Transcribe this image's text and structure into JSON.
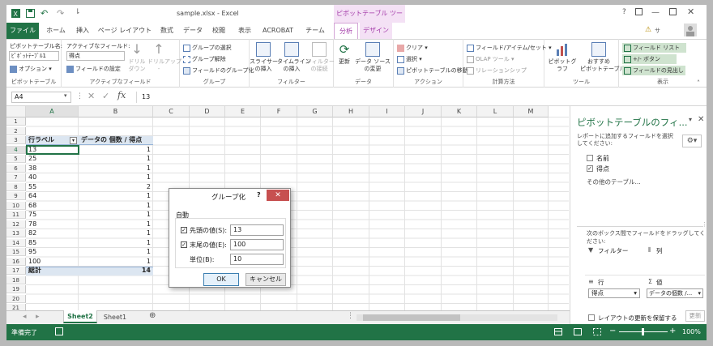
{
  "title": {
    "filename": "sample.xlsx - Excel",
    "context": "ピボットテーブル ツール",
    "help": "?",
    "user": "サ"
  },
  "tabs": [
    "ファイル",
    "ホーム",
    "挿入",
    "ページ レイアウト",
    "数式",
    "データ",
    "校閲",
    "表示",
    "ACROBAT",
    "チーム",
    "分析",
    "デザイン"
  ],
  "ribbon": {
    "pt_name_label": "ピボットテーブル名:",
    "pt_name_value": "ﾋﾟﾎﾞｯﾄﾃｰﾌﾞﾙ1",
    "options": "オプション",
    "g1": "ピボットテーブル",
    "active_field_label": "アクティブなフィールド:",
    "active_field_value": "得点",
    "field_settings": "フィールドの設定",
    "drill_down": "ドリル\nダウン",
    "drill_up": "ドリルアップ\n-",
    "g2": "アクティブなフィールド",
    "group_sel": "グループの選択",
    "ungroup": "グループ解除",
    "group_field": "フィールドのグループ化",
    "g3": "グループ",
    "slicer": "スライサー\nの挿入",
    "timeline": "タイムライン\nの挿入",
    "filter_conn": "フィルター\nの接続",
    "g4": "フィルター",
    "refresh": "更新",
    "change_source": "データ ソース\nの変更",
    "g5": "データ",
    "clear": "クリア",
    "select": "選択",
    "move_pt": "ピボットテーブルの移動",
    "g6": "アクション",
    "fields_items": "フィールド/アイテム/セット",
    "olap": "OLAP ツール",
    "relationships": "リレーションシップ",
    "g7": "計算方法",
    "pivot_chart": "ピボットグラフ",
    "recommended": "おすすめ\nピボットテーブル",
    "g8": "ツール",
    "field_list": "フィールド リスト",
    "plus_minus": "+/- ボタン",
    "field_headers": "フィールドの見出し",
    "g9": "表示"
  },
  "formula": {
    "namebox": "A4",
    "fx": "fx",
    "value": "13"
  },
  "columns": [
    "A",
    "B",
    "C",
    "D",
    "E",
    "F",
    "G",
    "H",
    "I",
    "J",
    "K",
    "L",
    "M"
  ],
  "rows": [
    "1",
    "2",
    "3",
    "4",
    "5",
    "6",
    "7",
    "8",
    "9",
    "10",
    "11",
    "12",
    "13",
    "14",
    "15",
    "16",
    "17",
    "18",
    "19",
    "20",
    "21",
    "22"
  ],
  "pivot": {
    "header_a": "行ラベル",
    "header_b": "データの 個数 / 得点",
    "labels": [
      "13",
      "25",
      "38",
      "40",
      "55",
      "64",
      "68",
      "75",
      "78",
      "82",
      "85",
      "95",
      "100"
    ],
    "counts": [
      "1",
      "1",
      "1",
      "1",
      "2",
      "1",
      "1",
      "1",
      "1",
      "1",
      "1",
      "1",
      "1"
    ],
    "total_label": "総計",
    "total_value": "14"
  },
  "dialog": {
    "title": "グループ化",
    "help": "?",
    "section": "自動",
    "start_label": "先頭の値(S):",
    "start_value": "13",
    "end_label": "末尾の値(E):",
    "end_value": "100",
    "step_label": "単位(B):",
    "step_value": "10",
    "ok": "OK",
    "cancel": "キャンセル"
  },
  "sheets": [
    "Sheet2",
    "Sheet1"
  ],
  "status": {
    "ready": "準備完了",
    "zoom": "100%"
  },
  "pane": {
    "title": "ピボットテーブルのフィ...",
    "subtitle": "レポートに追加するフィールドを選択してください:",
    "fields": [
      {
        "name": "名前",
        "checked": false
      },
      {
        "name": "得点",
        "checked": true
      }
    ],
    "more_tables": "その他のテーブル...",
    "drag_hint": "次のボックス間でフィールドをドラッグしてください:",
    "filter": "フィルター",
    "columns": "列",
    "rows": "行",
    "values": "値",
    "rows_item": "得点",
    "values_item": "データの個数 /...",
    "defer": "レイアウトの更新を保留する",
    "update": "更新"
  }
}
